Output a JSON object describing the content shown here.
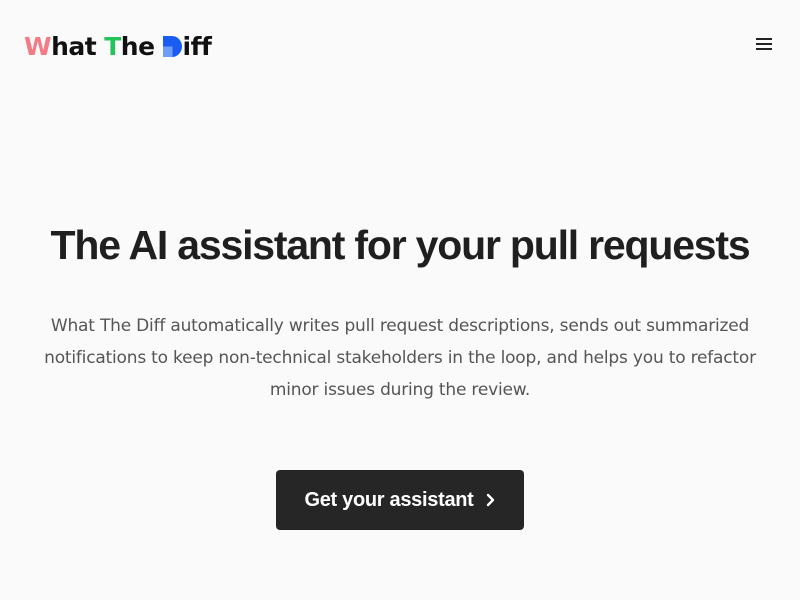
{
  "brand": {
    "logo_parts": {
      "w_letter": "W",
      "hat": "hat",
      "t_letter": "T",
      "he": "he",
      "iff": "iff"
    },
    "colors": {
      "w_accent": "#f27b86",
      "t_accent": "#25c35c",
      "d_accent_dark": "#1a5cf0",
      "d_accent_light": "#6f9df7"
    }
  },
  "header": {
    "menu_icon": "hamburger-menu-icon"
  },
  "hero": {
    "title": "The AI assistant for your pull requests",
    "description": "What The Diff automatically writes pull request descriptions, sends out summarized notifications to keep non-technical stakeholders in the loop, and helps you to refactor minor issues during the review.",
    "cta_label": "Get your assistant",
    "cta_icon": "chevron-right-icon"
  },
  "theme": {
    "background": "#fafafa",
    "text_dark": "#1f1f1f",
    "text_muted": "#555555",
    "button_bg": "#262626",
    "button_text": "#ffffff"
  }
}
